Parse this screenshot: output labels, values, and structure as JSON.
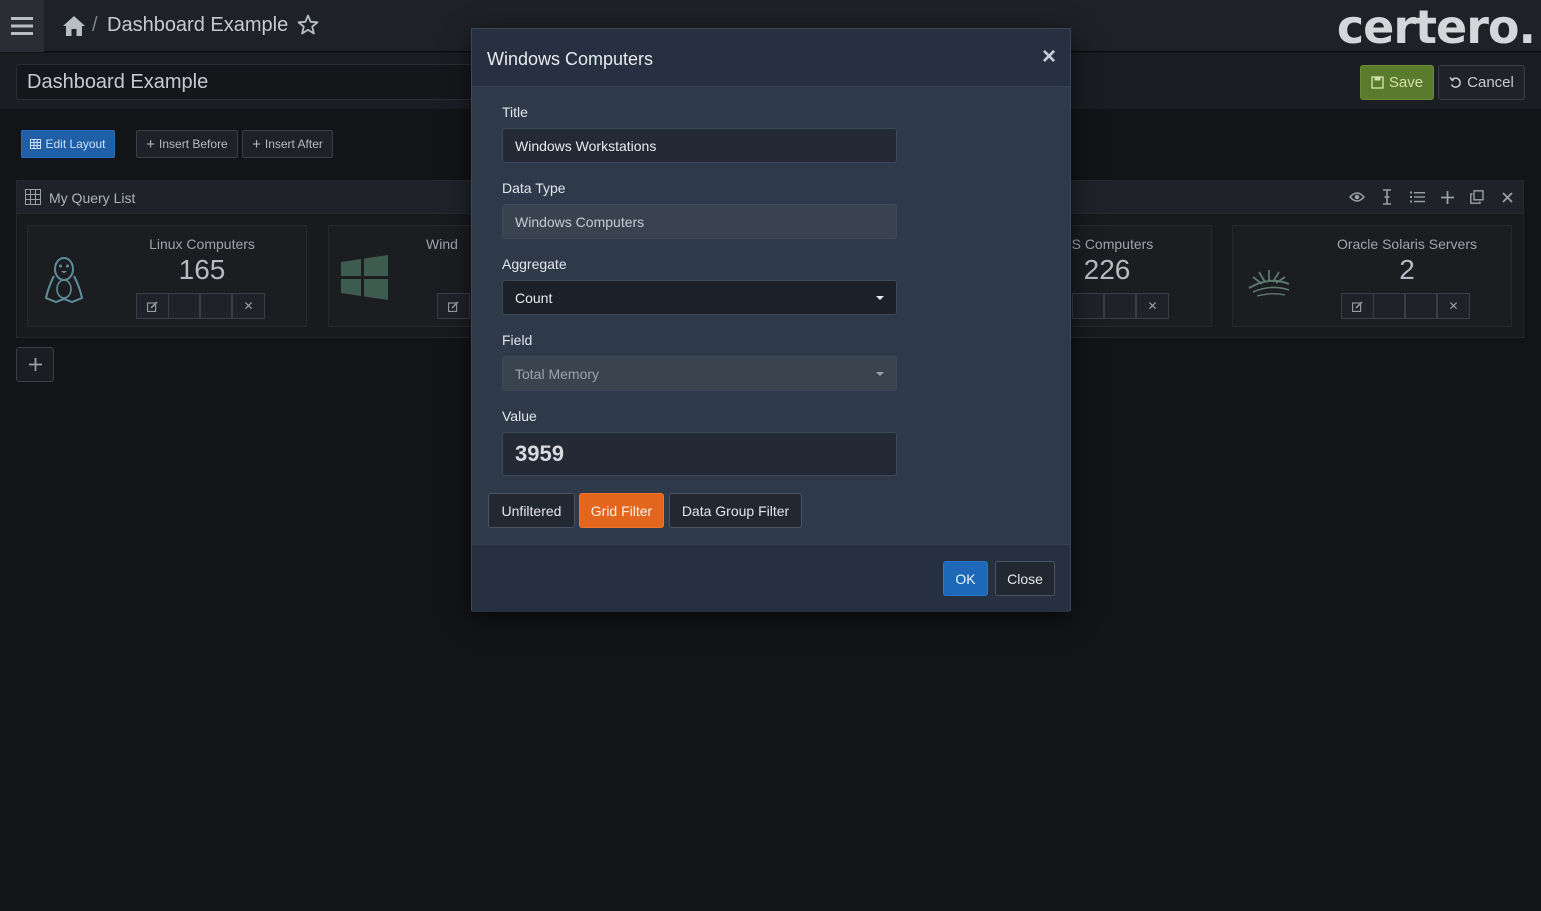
{
  "header": {
    "breadcrumb_sep": "/",
    "breadcrumb_title": "Dashboard Example",
    "brand": "certero."
  },
  "subheader": {
    "dashboard_name": "Dashboard Example",
    "save_label": "Save",
    "cancel_label": "Cancel"
  },
  "toolbar": {
    "edit_layout": "Edit Layout",
    "insert_before": "Insert Before",
    "insert_after": "Insert After"
  },
  "panel": {
    "title": "My Query List",
    "cards": [
      {
        "title": "Linux Computers",
        "value": "165"
      },
      {
        "title": "Wind",
        "value": ""
      },
      {
        "title": "OS Computers",
        "value": "226"
      },
      {
        "title": "Oracle Solaris Servers",
        "value": "2"
      }
    ]
  },
  "modal": {
    "title": "Windows Computers",
    "close_x": "×",
    "title_label": "Title",
    "title_value": "Windows Workstations",
    "datatype_label": "Data Type",
    "datatype_value": "Windows Computers",
    "aggregate_label": "Aggregate",
    "aggregate_value": "Count",
    "field_label": "Field",
    "field_value": "Total Memory",
    "value_label": "Value",
    "value_value": "3959",
    "filter_unfiltered": "Unfiltered",
    "filter_grid": "Grid Filter",
    "filter_group": "Data Group Filter",
    "ok_label": "OK",
    "close_label": "Close"
  },
  "colors": {
    "accent_blue": "#1e68b8",
    "accent_orange": "#e2661d",
    "save_green": "#5a7a2c"
  }
}
